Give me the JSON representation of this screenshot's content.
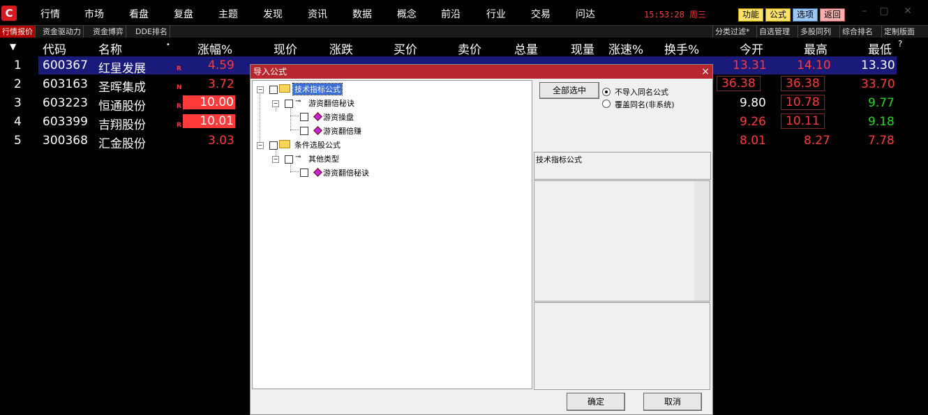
{
  "menu": {
    "logo": "C",
    "items": [
      "行情",
      "市场",
      "看盘",
      "复盘",
      "主题",
      "发现",
      "资讯",
      "数据",
      "概念",
      "前沿",
      "行业",
      "交易",
      "问达"
    ],
    "clock": "15:53:28 周三",
    "sys_buttons": [
      "功能",
      "公式",
      "选项",
      "返回"
    ]
  },
  "subtabs": {
    "left": [
      "行情报价",
      "资金驱动力",
      "资金博弈",
      "DDE排名"
    ],
    "right": [
      "分类过滤*",
      "自选管理",
      "多股同列",
      "综合排名",
      "定制版面"
    ]
  },
  "table": {
    "headers": [
      "代码",
      "名称",
      "涨幅%",
      "现价",
      "涨跌",
      "买价",
      "卖价",
      "总量",
      "现量",
      "涨速%",
      "换手%",
      "今开",
      "最高",
      "最低"
    ],
    "rows": [
      {
        "idx": "1",
        "code": "600367",
        "name": "红星发展",
        "tag": "R",
        "pct": "4.59",
        "open": "13.31",
        "high": "14.10",
        "low": "13.30"
      },
      {
        "idx": "2",
        "code": "603163",
        "name": "圣晖集成",
        "tag": "N",
        "pct": "3.72",
        "open": "36.38",
        "high": "36.38",
        "low": "33.70"
      },
      {
        "idx": "3",
        "code": "603223",
        "name": "恒通股份",
        "tag": "R",
        "pct": "10.00",
        "open": "9.80",
        "high": "10.78",
        "low": "9.77"
      },
      {
        "idx": "4",
        "code": "603399",
        "name": "吉翔股份",
        "tag": "R",
        "pct": "10.01",
        "open": "9.26",
        "high": "10.11",
        "low": "9.18"
      },
      {
        "idx": "5",
        "code": "300368",
        "name": "汇金股份",
        "tag": "",
        "pct": "3.03",
        "open": "8.01",
        "high": "8.27",
        "low": "7.78"
      }
    ]
  },
  "dialog": {
    "title": "导入公式",
    "close": "×",
    "tree": {
      "group1": "技术指标公式",
      "group1_child": "游资翻倍秘诀",
      "group1_leaf1": "游资操盘",
      "group1_leaf2": "游资翻倍赚",
      "group2": "条件选股公式",
      "group2_child": "其他类型",
      "group2_leaf1": "游资翻倍秘诀"
    },
    "select_all": "全部选中",
    "radio1": "不导入同名公式",
    "radio2": "覆盖同名(非系统)",
    "info_label": "技术指标公式",
    "ok": "确定",
    "cancel": "取消"
  },
  "colors": {
    "up": "#ff3b3b",
    "down": "#23d923",
    "selected_row": "#1a1a7a",
    "dialog_title": "#b8262f"
  }
}
